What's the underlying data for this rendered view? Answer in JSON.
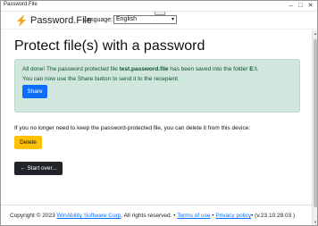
{
  "window": {
    "title": "Password.File",
    "controls": [
      "–",
      "□",
      "✕"
    ]
  },
  "header": {
    "brand": "Password.File",
    "language_label": "Language:",
    "language_value": "English"
  },
  "main": {
    "title": "Protect file(s) with a password"
  },
  "alert": {
    "part1": "All done! The password protected file ",
    "filename": "test.password.file",
    "part2": " has been saved into the folder ",
    "folder": "E:\\",
    "part3": ".",
    "line2": "You can now use the Share button to send it to the recepient.",
    "share_label": "Share"
  },
  "delete": {
    "text": "If you no longer need to keep the password-protected file, you can delete it from this device:",
    "button_label": "Delete"
  },
  "start_over_label": "← Start over...",
  "footer": {
    "copyright": "Copyright © 2023 ",
    "company": "WinAbility Software Corp",
    "rights": ". All rights reserved. • ",
    "terms": "Terms of use",
    "sep": " • ",
    "privacy": "Privacy policy",
    "version": "• (v.23.10.29.03 )"
  },
  "colors": {
    "accent": "#0d6efd",
    "success_bg": "#d1e7dd",
    "warning": "#ffc107",
    "dark": "#212529",
    "logo": "#f0a31c"
  },
  "icons": {
    "logo": "lightning-bolt-icon"
  }
}
